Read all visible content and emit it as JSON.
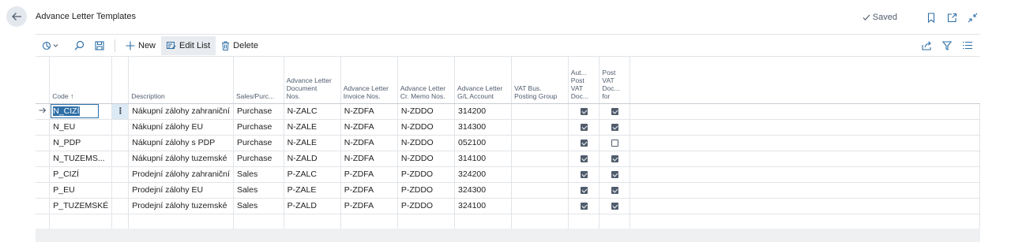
{
  "header": {
    "title": "Advance Letter Templates",
    "saved_label": "Saved"
  },
  "toolbar": {
    "new_label": "New",
    "edit_list_label": "Edit List",
    "delete_label": "Delete"
  },
  "columns": {
    "code": "Code",
    "code_sort": "↑",
    "description": "Description",
    "sales_purchase": "Sales/Purc...",
    "doc_nos": [
      "Advance Letter",
      "Document",
      "Nos."
    ],
    "invoice_nos": [
      "Advance Letter",
      "Invoice Nos."
    ],
    "cr_memo_nos": [
      "Advance Letter",
      "Cr. Memo Nos."
    ],
    "gl_account": [
      "Advance Letter",
      "G/L Account"
    ],
    "vat_bus": [
      "VAT Bus.",
      "Posting Group"
    ],
    "auto_post": [
      "Aut...",
      "Post",
      "VAT",
      "Doc..."
    ],
    "post_vat": [
      "Post",
      "VAT",
      "Doc...",
      "for"
    ]
  },
  "rows": [
    {
      "code": "N_CIZÍ",
      "description": "Nákupní zálohy zahraniční",
      "type": "Purchase",
      "doc_nos": "N-ZALC",
      "inv_nos": "N-ZDFA",
      "cr_nos": "N-ZDDO",
      "gl": "314200",
      "vat_bus": "",
      "auto_post": true,
      "post_vat": true
    },
    {
      "code": "N_EU",
      "description": "Nákupní zálohy EU",
      "type": "Purchase",
      "doc_nos": "N-ZALE",
      "inv_nos": "N-ZDFA",
      "cr_nos": "N-ZDDO",
      "gl": "314300",
      "vat_bus": "",
      "auto_post": true,
      "post_vat": true
    },
    {
      "code": "N_PDP",
      "description": "Nákupní zálohy s PDP",
      "type": "Purchase",
      "doc_nos": "N-ZALE",
      "inv_nos": "N-ZDFA",
      "cr_nos": "N-ZDDO",
      "gl": "052100",
      "vat_bus": "",
      "auto_post": true,
      "post_vat": false
    },
    {
      "code": "N_TUZEMS...",
      "description": "Nákupní zálohy tuzemské",
      "type": "Purchase",
      "doc_nos": "N-ZALD",
      "inv_nos": "N-ZDFA",
      "cr_nos": "N-ZDDO",
      "gl": "314100",
      "vat_bus": "",
      "auto_post": true,
      "post_vat": true
    },
    {
      "code": "P_CIZÍ",
      "description": "Prodejní zálohy zahraniční",
      "type": "Sales",
      "doc_nos": "P-ZALC",
      "inv_nos": "P-ZDFA",
      "cr_nos": "P-ZDDO",
      "gl": "324200",
      "vat_bus": "",
      "auto_post": true,
      "post_vat": true
    },
    {
      "code": "P_EU",
      "description": "Prodejní zálohy EU",
      "type": "Sales",
      "doc_nos": "P-ZALE",
      "inv_nos": "P-ZDFA",
      "cr_nos": "P-ZDDO",
      "gl": "324300",
      "vat_bus": "",
      "auto_post": true,
      "post_vat": true
    },
    {
      "code": "P_TUZEMSKÉ",
      "description": "Prodejní zálohy tuzemské",
      "type": "Sales",
      "doc_nos": "P-ZALD",
      "inv_nos": "P-ZDFA",
      "cr_nos": "P-ZDDO",
      "gl": "324100",
      "vat_bus": "",
      "auto_post": true,
      "post_vat": true
    }
  ],
  "colors": {
    "accent": "#2f6fa7",
    "text": "#212121",
    "muted": "#505c6d"
  }
}
